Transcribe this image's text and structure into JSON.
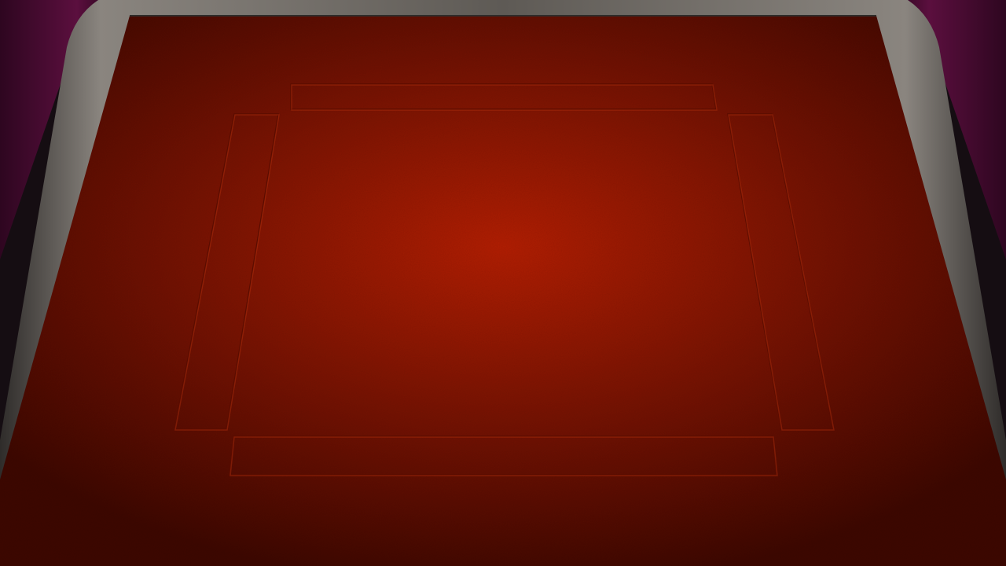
{
  "game": {
    "board_type": "mahjong-table",
    "colors": {
      "backdrop": "#150d12",
      "cushion": "#5b0f3e",
      "cushion_dark": "#2e0620",
      "frame": "#5e5a55",
      "frame_light": "#8a857f",
      "frame_dark": "#2f2c2a",
      "felt_center": "#b41e02",
      "felt_mid": "#7e1402",
      "felt_edge": "#3e0700",
      "groove": "#5a0c00",
      "groove_highlight": "#c93a12"
    },
    "seat_zones": [
      {
        "seat": "top",
        "state": "empty"
      },
      {
        "seat": "left",
        "state": "empty"
      },
      {
        "seat": "right",
        "state": "empty"
      },
      {
        "seat": "bottom",
        "state": "empty"
      }
    ]
  }
}
